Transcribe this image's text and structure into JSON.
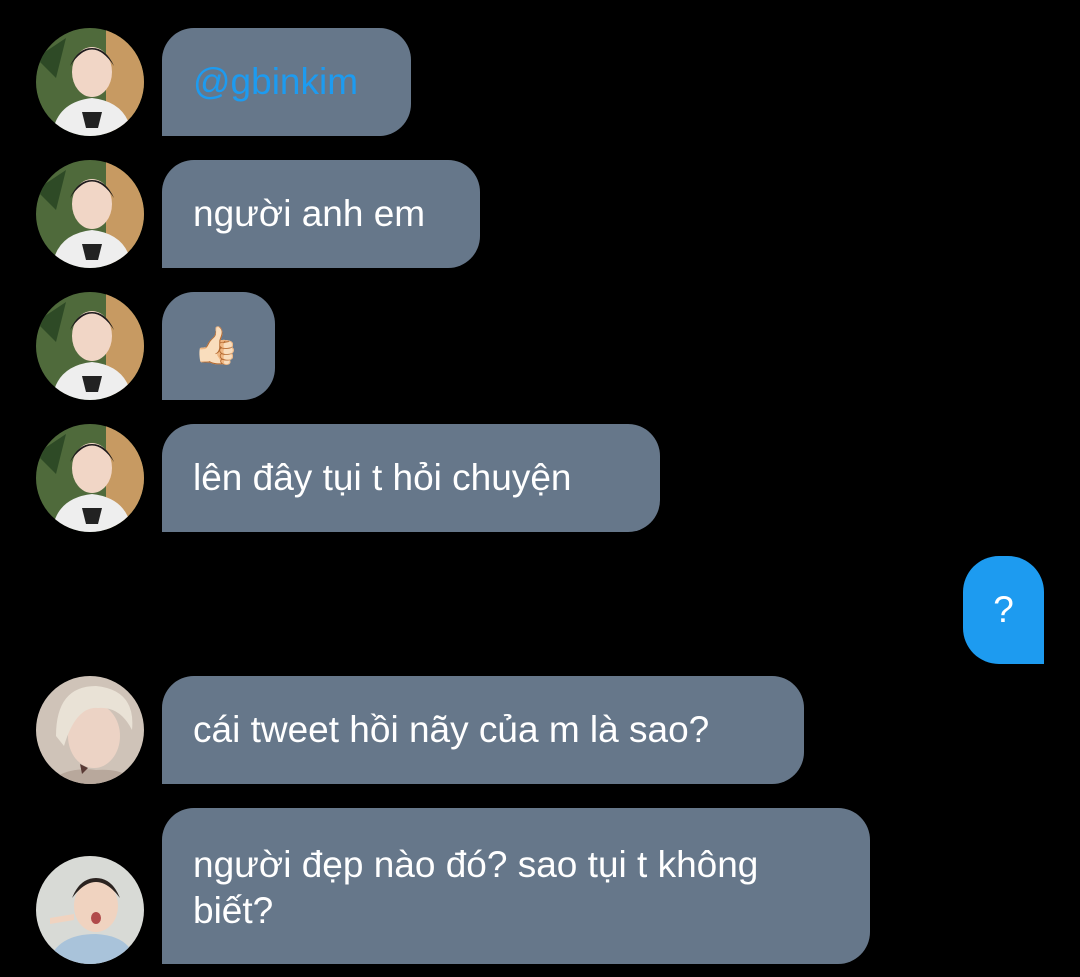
{
  "messages": [
    {
      "sender": "incoming",
      "text": "@gbinkim",
      "is_mention": true
    },
    {
      "sender": "incoming",
      "text": "người anh em"
    },
    {
      "sender": "incoming",
      "emoji": "👍🏻"
    },
    {
      "sender": "incoming",
      "text": "lên đây tụi t hỏi chuyện"
    },
    {
      "sender": "outgoing",
      "text": "?"
    },
    {
      "sender": "incoming",
      "text": "cái tweet hồi nãy của m là sao?"
    },
    {
      "sender": "incoming",
      "text": "người đẹp nào đó? sao tụi t không biết?"
    }
  ],
  "colors": {
    "background": "#000000",
    "incoming_bubble": "#66778a",
    "outgoing_bubble": "#1d9bf0",
    "mention": "#1d9bf0",
    "text": "#ffffff"
  }
}
